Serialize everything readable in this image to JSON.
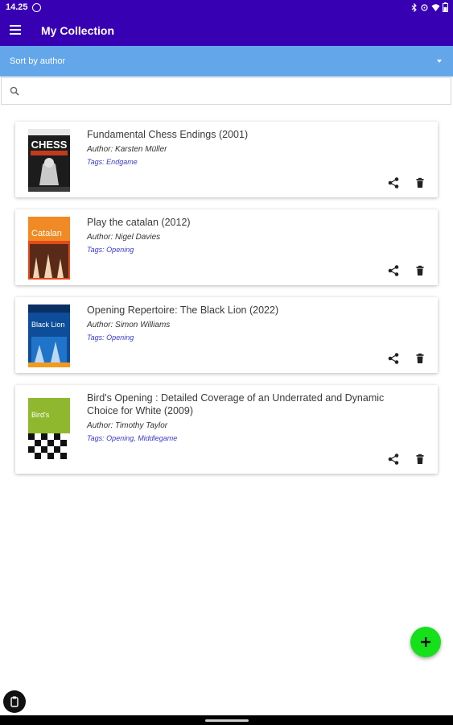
{
  "status_bar": {
    "time": "14.25"
  },
  "app_bar": {
    "title": "My Collection",
    "color": "#3700b3"
  },
  "sort": {
    "label": "Sort by author",
    "color": "#64a6ea"
  },
  "search": {
    "value": "",
    "placeholder": ""
  },
  "books": [
    {
      "title": "Fundamental Chess Endings (2001)",
      "author": "Author: Karsten Müller",
      "tags": "Tags: Endgame",
      "cover_text": "CHESS"
    },
    {
      "title": "Play the catalan (2012)",
      "author": "Author: Nigel Davies",
      "tags": "Tags: Opening",
      "cover_text": "Catalan"
    },
    {
      "title": "Opening Repertoire: The Black Lion (2022)",
      "author": "Author: Simon Williams",
      "tags": "Tags: Opening",
      "cover_text": "Black Lion"
    },
    {
      "title": "Bird's Opening : Detailed Coverage of an Underrated and Dynamic Choice for White (2009)",
      "author": "Author: Timothy Taylor",
      "tags": "Tags: Opening, Middlegame",
      "cover_text": "Bird's"
    }
  ],
  "fab": {
    "icon": "plus-icon",
    "color": "#15e01a"
  },
  "accent_tags_color": "#3b3bcf"
}
